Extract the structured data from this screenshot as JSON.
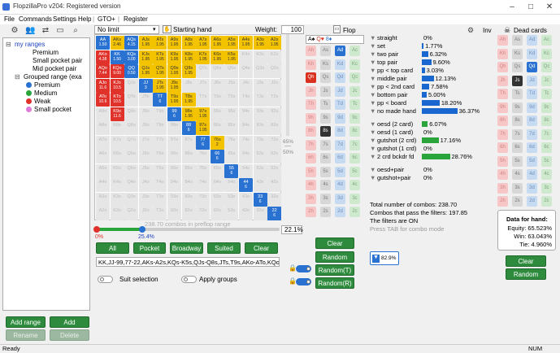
{
  "window": {
    "title": "FlopzillaPro v204: Registered version",
    "min": "–",
    "max": "□",
    "close": "✕"
  },
  "menu": [
    "File",
    "Commands",
    "Settings",
    "Help",
    "|",
    "GTO+",
    "|",
    "Register"
  ],
  "tree": {
    "root": "my ranges",
    "items": [
      "Premium",
      "Small pocket pair",
      "Mid pocket pair"
    ],
    "group": "Grouped range (exa",
    "group_items": [
      {
        "label": "Premium",
        "color": "#2a72d2"
      },
      {
        "label": "Medium",
        "color": "#2aa53b"
      },
      {
        "label": "Weak",
        "color": "#e0312a"
      },
      {
        "label": "Small pocket",
        "color": "#e07ad8"
      }
    ]
  },
  "left_buttons": {
    "add_range": "Add range",
    "add_category": "Add category",
    "rename": "Rename",
    "delete": "Delete"
  },
  "range": {
    "limit": "No limit",
    "starting_hand": "Starting hand",
    "weight_label": "Weight:",
    "weight": "100",
    "combos_text": "238.70 combos in preflop range",
    "slider_left": "0%",
    "slider_mark": "25.4%",
    "slider_pct": "22.1%",
    "side_pct_1": "65%",
    "side_pct_2": "50%",
    "buttons": [
      "All",
      "Pocket",
      "Broadway",
      "Suited",
      "Clear"
    ],
    "range_text": "KK,JJ-99,77-22,AKs-A2s,KQs-K5s,QJs-Q8s,JTs,T9s,AKo-ATo,KQo-KTo",
    "suit_selection": "Suit selection",
    "apply_groups": "Apply groups"
  },
  "grid": [
    [
      "AA|1.50",
      "AKs|2.46",
      "AQs|4.15",
      "AJs|1.95",
      "ATs|1.95",
      "A9s|1.95",
      "A8s|1.95",
      "A7s|1.95",
      "A6s|1.95",
      "A5s|1.95",
      "A4s|1.95",
      "A3s|1.95",
      "A2s|1.95"
    ],
    [
      "AKo|4.38",
      "KK|1.50",
      "KQs|3.00",
      "KJs|1.95",
      "KTs|1.95",
      "K9s|1.95",
      "K8s|1.95",
      "K7s|1.95",
      "K6s|1.95",
      "K5s|1.95",
      "K4s|",
      "K3s|",
      "K2s|"
    ],
    [
      "AQo|7.44",
      "KQo|9.00",
      "QQ|0.50",
      "QJs|1.95",
      "QTs|1.95",
      "Q9s|1.95",
      "Q8s|1.95",
      "Q7s|",
      "Q6s|",
      "Q5s|",
      "Q4s|",
      "Q3s|",
      "Q2s|"
    ],
    [
      "AJo|11.6",
      "KJo|10.5",
      "QJo|",
      "JJ|3",
      "JTs|1.95",
      "J9s|1.95",
      "J8s|",
      "J7s|",
      "J6s|",
      "J5s|",
      "J4s|",
      "J3s|",
      "J2s|"
    ],
    [
      "ATo|10.6",
      "KTo|10.5",
      "QTo|",
      "JTo|",
      "TT|6",
      "T9s|1.95",
      "T8s|1.95",
      "T7s|",
      "T6s|",
      "T5s|",
      "T4s|",
      "T3s|",
      "T2s|"
    ],
    [
      "A9o|",
      "K9o|11.6",
      "Q9o|",
      "J9o|",
      "T9o|",
      "99|6",
      "98s|1.95",
      "97s|1.95",
      "96s|",
      "95s|",
      "94s|",
      "93s|",
      "92s|"
    ],
    [
      "A8o|",
      "K8o|",
      "Q8o|",
      "J8o|",
      "T8o|",
      "98o|",
      "88|6",
      "87s|1.95",
      "86s|",
      "85s|",
      "84s|",
      "83s|",
      "82s|"
    ],
    [
      "A7o|",
      "K7o|",
      "Q7o|",
      "J7o|",
      "T7o|",
      "97o|",
      "87o|",
      "77|6",
      "76s|2",
      "75s|",
      "74s|",
      "73s|",
      "72s|"
    ],
    [
      "A6o|",
      "K6o|",
      "Q6o|",
      "J6o|",
      "T6o|",
      "96o|",
      "86o|",
      "76o|",
      "66|6",
      "65s|",
      "64s|",
      "63s|",
      "62s|"
    ],
    [
      "A5o|",
      "K5o|",
      "Q5o|",
      "J5o|",
      "T5o|",
      "95o|",
      "85o|",
      "75o|",
      "65o|",
      "55|6",
      "54s|",
      "53s|",
      "52s|"
    ],
    [
      "A4o|",
      "K4o|",
      "Q4o|",
      "J4o|",
      "T4o|",
      "94o|",
      "84o|",
      "74o|",
      "64o|",
      "54o|",
      "44|6",
      "43s|",
      "42s|"
    ],
    [
      "A3o|",
      "K3o|",
      "Q3o|",
      "J3o|",
      "T3o|",
      "93o|",
      "83o|",
      "73o|",
      "63o|",
      "53o|",
      "43o|",
      "33|6",
      "32s|"
    ],
    [
      "A2o|",
      "K2o|",
      "Q2o|",
      "J2o|",
      "T2o|",
      "92o|",
      "82o|",
      "72o|",
      "62o|",
      "52o|",
      "42o|",
      "32o|",
      "22|6"
    ]
  ],
  "flop": {
    "title": "Flop",
    "clear": "Clear",
    "random": "Random",
    "random_t": "Random(T)",
    "random_r": "Random(R)",
    "suits": [
      "A♠",
      "Q♥",
      "8♦"
    ]
  },
  "stats": [
    {
      "label": "straight",
      "value": "0%",
      "pct": 0,
      "color": "blue"
    },
    {
      "label": "set",
      "value": "1.77%",
      "pct": 1.77,
      "color": "blue"
    },
    {
      "label": "two pair",
      "value": "6.32%",
      "pct": 6.32,
      "color": "blue"
    },
    {
      "label": "top pair",
      "value": "9.60%",
      "pct": 9.6,
      "color": "blue"
    },
    {
      "label": "pp < top card",
      "value": "3.03%",
      "pct": 3.03,
      "color": "blue"
    },
    {
      "label": "middle pair",
      "value": "12.13%",
      "pct": 12.13,
      "color": "blue"
    },
    {
      "label": "pp < 2nd card",
      "value": "7.58%",
      "pct": 7.58,
      "color": "blue"
    },
    {
      "label": "bottom pair",
      "value": "5.00%",
      "pct": 5,
      "color": "blue"
    },
    {
      "label": "pp < board",
      "value": "18.20%",
      "pct": 18.2,
      "color": "blue"
    },
    {
      "label": "no made hand",
      "value": "36.37%",
      "pct": 36.37,
      "color": "blue"
    },
    {
      "label": "oesd (2 card)",
      "value": "6.07%",
      "pct": 6.07,
      "color": "green"
    },
    {
      "label": "oesd (1 card)",
      "value": "0%",
      "pct": 0,
      "color": "green"
    },
    {
      "label": "gutshot (2 crd)",
      "value": "17.16%",
      "pct": 17.16,
      "color": "green"
    },
    {
      "label": "gutshot (1 crd)",
      "value": "0%",
      "pct": 0,
      "color": "green"
    },
    {
      "label": "2 crd bckdr fd",
      "value": "28.76%",
      "pct": 28.76,
      "color": "green"
    },
    {
      "label": "oesd+pair",
      "value": "0%",
      "pct": 0,
      "color": "green"
    },
    {
      "label": "gutshot+pair",
      "value": "0%",
      "pct": 0,
      "color": "green"
    }
  ],
  "summary": {
    "total": "Total number of combos: 238.70",
    "pass": "Combos that pass the filters: 197.85",
    "filters": "The filters are ON",
    "hint": "Press TAB for combo mode",
    "badge": "82.9%"
  },
  "inv": {
    "label": "Inv"
  },
  "dead": {
    "title": "Dead cards",
    "data_title": "Data for hand:",
    "equity": "Equity: 65.523%",
    "win": "Win: 63.043%",
    "tie": "Tie: 4.960%",
    "clear": "Clear",
    "random": "Random"
  },
  "status": {
    "left": "Ready",
    "right": "NUM"
  },
  "colors": {
    "accent": "#2a72d2",
    "green": "#2e8b3d",
    "red": "#e0312a",
    "yellow": "#f4c300"
  }
}
